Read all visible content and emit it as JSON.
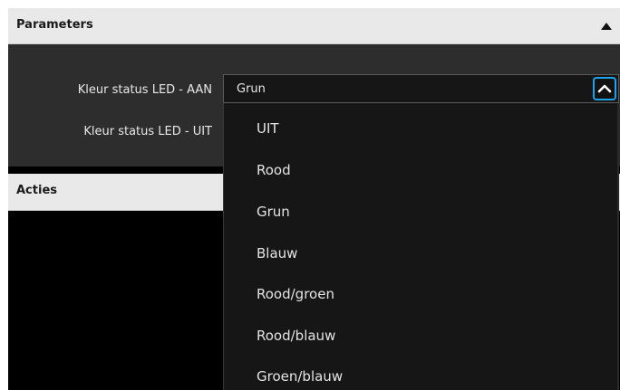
{
  "parameters_panel": {
    "title": "Parameters",
    "fields": [
      {
        "label": "Kleur status LED - AAN",
        "value": "Grun"
      },
      {
        "label": "Kleur status LED - UIT"
      }
    ]
  },
  "acties_panel": {
    "title": "Acties"
  },
  "dropdown": {
    "options": [
      "UIT",
      "Rood",
      "Grun",
      "Blauw",
      "Rood/groen",
      "Rood/blauw",
      "Groen/blauw"
    ]
  },
  "colors": {
    "header_bg": "#e9e9e9",
    "body_bg": "#2d2d2d",
    "dropdown_bg": "#161616",
    "focus_accent": "#1fa3ea"
  },
  "icons": {
    "collapse": "triangle-up-icon",
    "select_toggle": "chevron-up-icon"
  }
}
